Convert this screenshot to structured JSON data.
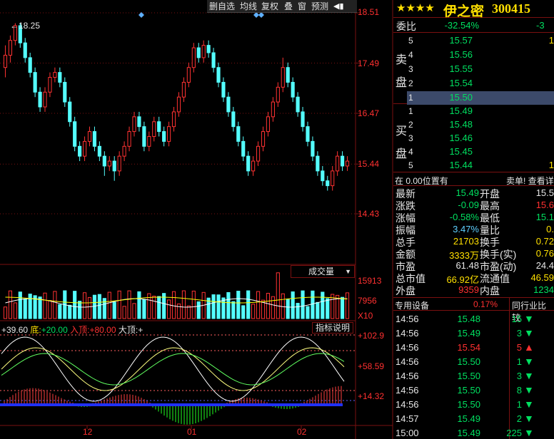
{
  "toolbar": {
    "items": [
      "删自选",
      "均线",
      "复权",
      "叠",
      "窗",
      "预测"
    ]
  },
  "main_chart": {
    "price_ticks": [
      "18.51",
      "17.49",
      "16.47",
      "15.44",
      "14.43"
    ],
    "high_marker": "18.25",
    "volume_selector": "成交量",
    "volume_ticks": [
      "15913",
      "7956",
      "X10"
    ],
    "indicator_header": {
      "a": "+39.60",
      "b_label": "底:",
      "b": "+20.00",
      "c_label": "入顶:",
      "c": "+80.00",
      "d_label": "大顶:",
      "d": "+"
    },
    "indicator_button": "指标说明",
    "indicator_ticks": [
      "+102.9",
      "+58.59",
      "+14.32"
    ],
    "x_labels": [
      "12",
      "01",
      "02"
    ]
  },
  "stock": {
    "stars": "★★★★",
    "name": "伊之密",
    "code": "300415"
  },
  "order_book": {
    "wei_bi_label": "委比",
    "wei_bi": "-32.54%",
    "wei_cha": "-3",
    "sell_label": [
      "卖",
      "盘"
    ],
    "buy_label": [
      "买",
      "盘"
    ],
    "sell": [
      {
        "level": "5",
        "price": "15.57",
        "vol": "1"
      },
      {
        "level": "4",
        "price": "15.56",
        "vol": ""
      },
      {
        "level": "3",
        "price": "15.55",
        "vol": ""
      },
      {
        "level": "2",
        "price": "15.54",
        "vol": ""
      },
      {
        "level": "1",
        "price": "15.50",
        "vol": ""
      }
    ],
    "buy": [
      {
        "level": "1",
        "price": "15.49",
        "vol": ""
      },
      {
        "level": "2",
        "price": "15.48",
        "vol": ""
      },
      {
        "level": "3",
        "price": "15.46",
        "vol": ""
      },
      {
        "level": "4",
        "price": "15.45",
        "vol": ""
      },
      {
        "level": "5",
        "price": "15.44",
        "vol": "1"
      }
    ],
    "status_left": "在 0.00位置有",
    "status_right": "卖单! 查看详"
  },
  "quote": {
    "rows": [
      {
        "l1": "最新",
        "v1": "15.49",
        "c1": "green",
        "l2": "开盘",
        "v2": "15.5",
        "c2": "white"
      },
      {
        "l1": "涨跌",
        "v1": "-0.09",
        "c1": "green",
        "l2": "最高",
        "v2": "15.6",
        "c2": "red"
      },
      {
        "l1": "涨幅",
        "v1": "-0.58%",
        "c1": "green",
        "l2": "最低",
        "v2": "15.1",
        "c2": "green"
      },
      {
        "l1": "振幅",
        "v1": "3.47%",
        "c1": "cyan",
        "l2": "量比",
        "v2": "0.",
        "c2": "yellow"
      },
      {
        "l1": "总手",
        "v1": "21703",
        "c1": "yellow",
        "l2": "换手",
        "v2": "0.72",
        "c2": "yellow"
      },
      {
        "l1": "金额",
        "v1": "3333万",
        "c1": "yellow",
        "l2": "换手(实)",
        "v2": "0.76",
        "c2": "yellow"
      },
      {
        "l1": "市盈",
        "v1": "61.48",
        "c1": "white",
        "l2": "市盈(动)",
        "v2": "24.4",
        "c2": "white"
      },
      {
        "l1": "总市值",
        "v1": "66.92亿",
        "c1": "yellow",
        "l2": "流通值",
        "v2": "46.59",
        "c2": "yellow"
      },
      {
        "l1": "外盘",
        "v1": "9359",
        "c1": "red",
        "l2": "内盘",
        "v2": "1234",
        "c2": "green"
      }
    ]
  },
  "sector": {
    "name": "专用设备",
    "pct": "0.17%",
    "peer_label": "同行业比较"
  },
  "ticks": [
    {
      "time": "14:56",
      "price": "15.48",
      "vol": "15",
      "dir": "down"
    },
    {
      "time": "14:56",
      "price": "15.49",
      "vol": "3",
      "dir": "down"
    },
    {
      "time": "14:56",
      "price": "15.54",
      "vol": "5",
      "dir": "up"
    },
    {
      "time": "14:56",
      "price": "15.50",
      "vol": "1",
      "dir": "down"
    },
    {
      "time": "14:56",
      "price": "15.50",
      "vol": "3",
      "dir": "down"
    },
    {
      "time": "14:56",
      "price": "15.50",
      "vol": "8",
      "dir": "down"
    },
    {
      "time": "14:56",
      "price": "15.50",
      "vol": "1",
      "dir": "down"
    },
    {
      "time": "14:57",
      "price": "15.49",
      "vol": "2",
      "dir": "down"
    },
    {
      "time": "15:00",
      "price": "15.49",
      "vol": "225",
      "dir": "down"
    }
  ],
  "colors": {
    "up": "#ff3232",
    "down": "#54ffff",
    "grid": "#7a1010",
    "bg": "#000000"
  },
  "chart_data": {
    "type": "candlestick",
    "y_ticks": [
      18.51,
      17.49,
      16.47,
      15.44,
      14.43
    ],
    "candles": [
      [
        17.4,
        17.65,
        17.2,
        17.85
      ],
      [
        17.65,
        17.95,
        17.5,
        18.05
      ],
      [
        17.95,
        18.25,
        17.85,
        18.3
      ],
      [
        18.25,
        17.9,
        17.8,
        18.3
      ],
      [
        17.9,
        17.6,
        17.5,
        18.0
      ],
      [
        17.6,
        17.3,
        17.2,
        17.7
      ],
      [
        17.3,
        16.9,
        16.8,
        17.4
      ],
      [
        16.9,
        16.6,
        16.5,
        17.0
      ],
      [
        16.6,
        16.9,
        16.5,
        17.0
      ],
      [
        16.9,
        17.2,
        16.8,
        17.3
      ],
      [
        17.2,
        17.3,
        17.1,
        17.4
      ],
      [
        17.3,
        17.1,
        17.0,
        17.4
      ],
      [
        17.1,
        16.7,
        16.6,
        17.2
      ],
      [
        16.7,
        16.3,
        16.2,
        16.8
      ],
      [
        16.3,
        15.8,
        15.7,
        16.4
      ],
      [
        15.8,
        15.6,
        15.5,
        15.9
      ],
      [
        15.6,
        15.9,
        15.5,
        16.0
      ],
      [
        15.9,
        16.1,
        15.8,
        16.2
      ],
      [
        16.1,
        15.8,
        15.7,
        16.2
      ],
      [
        15.8,
        15.6,
        15.5,
        15.9
      ],
      [
        15.6,
        15.4,
        15.2,
        15.7
      ],
      [
        15.4,
        15.5,
        15.3,
        15.6
      ],
      [
        15.5,
        15.3,
        15.1,
        15.6
      ],
      [
        15.3,
        15.6,
        15.2,
        15.7
      ],
      [
        15.6,
        15.8,
        15.5,
        15.9
      ],
      [
        15.8,
        16.1,
        15.7,
        16.2
      ],
      [
        16.1,
        16.4,
        16.0,
        16.5
      ],
      [
        16.4,
        16.2,
        16.1,
        16.5
      ],
      [
        16.2,
        15.8,
        15.7,
        16.3
      ],
      [
        15.8,
        16.0,
        15.7,
        16.1
      ],
      [
        16.0,
        16.3,
        15.9,
        16.4
      ],
      [
        16.3,
        16.1,
        16.0,
        16.4
      ],
      [
        16.1,
        15.9,
        15.8,
        16.2
      ],
      [
        15.9,
        16.2,
        15.8,
        16.3
      ],
      [
        16.2,
        16.5,
        16.1,
        16.6
      ],
      [
        16.5,
        16.8,
        16.4,
        16.9
      ],
      [
        16.8,
        17.1,
        16.7,
        17.2
      ],
      [
        17.1,
        17.4,
        17.0,
        17.5
      ],
      [
        17.4,
        17.8,
        17.3,
        17.9
      ],
      [
        17.8,
        17.6,
        17.5,
        17.9
      ],
      [
        17.6,
        17.85,
        17.5,
        17.95
      ],
      [
        17.85,
        17.7,
        17.6,
        17.95
      ],
      [
        17.7,
        17.4,
        17.3,
        17.8
      ],
      [
        17.4,
        17.1,
        17.0,
        17.5
      ],
      [
        17.1,
        16.8,
        16.7,
        17.2
      ],
      [
        16.8,
        16.5,
        16.4,
        16.9
      ],
      [
        16.5,
        16.2,
        16.1,
        16.6
      ],
      [
        16.2,
        15.9,
        15.8,
        16.3
      ],
      [
        15.9,
        15.6,
        15.5,
        16.0
      ],
      [
        15.6,
        15.3,
        15.2,
        15.7
      ],
      [
        15.3,
        15.5,
        15.2,
        15.6
      ],
      [
        15.5,
        15.8,
        15.4,
        15.9
      ],
      [
        15.8,
        16.1,
        15.7,
        16.2
      ],
      [
        16.1,
        16.4,
        16.0,
        16.5
      ],
      [
        16.4,
        16.7,
        16.3,
        16.8
      ],
      [
        16.7,
        17.0,
        16.6,
        17.1
      ],
      [
        17.0,
        17.4,
        16.9,
        17.6
      ],
      [
        17.4,
        17.1,
        17.0,
        17.5
      ],
      [
        17.1,
        16.8,
        16.7,
        17.2
      ],
      [
        16.8,
        16.5,
        16.4,
        16.9
      ],
      [
        16.5,
        16.2,
        16.1,
        16.6
      ],
      [
        16.2,
        15.9,
        15.8,
        16.3
      ],
      [
        15.9,
        15.6,
        15.5,
        16.0
      ],
      [
        15.6,
        15.3,
        15.2,
        15.7
      ],
      [
        15.3,
        15.1,
        15.0,
        15.4
      ],
      [
        15.1,
        15.0,
        14.9,
        15.2
      ],
      [
        15.0,
        15.3,
        14.9,
        15.4
      ],
      [
        15.3,
        15.6,
        15.2,
        15.7
      ],
      [
        15.6,
        15.4,
        15.3,
        15.7
      ],
      [
        15.4,
        15.5,
        15.3,
        15.6
      ]
    ],
    "volume_max": 15913
  }
}
